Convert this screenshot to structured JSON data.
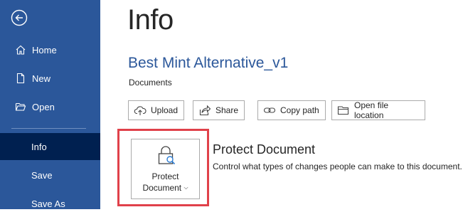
{
  "sidebar": {
    "back_icon": "back-arrow-icon",
    "items": [
      {
        "label": "Home",
        "icon": "home-icon"
      },
      {
        "label": "New",
        "icon": "new-document-icon"
      },
      {
        "label": "Open",
        "icon": "open-folder-icon"
      },
      {
        "label": "Info",
        "active": true
      },
      {
        "label": "Save"
      },
      {
        "label": "Save As"
      }
    ]
  },
  "main": {
    "page_title": "Info",
    "document_title": "Best Mint Alternative_v1",
    "document_location": "Documents",
    "actions": [
      {
        "label": "Upload",
        "icon": "upload-icon"
      },
      {
        "label": "Share",
        "icon": "share-icon"
      },
      {
        "label": "Copy path",
        "icon": "link-icon"
      },
      {
        "label": "Open file location",
        "icon": "folder-icon"
      }
    ],
    "protect": {
      "button_line1": "Protect",
      "button_line2": "Document",
      "heading": "Protect Document",
      "description": "Control what types of changes people can make to this document."
    }
  },
  "colors": {
    "sidebar_bg": "#2b579a",
    "sidebar_active": "#002050",
    "accent_title": "#2b579a",
    "highlight_box": "#e0414a"
  }
}
